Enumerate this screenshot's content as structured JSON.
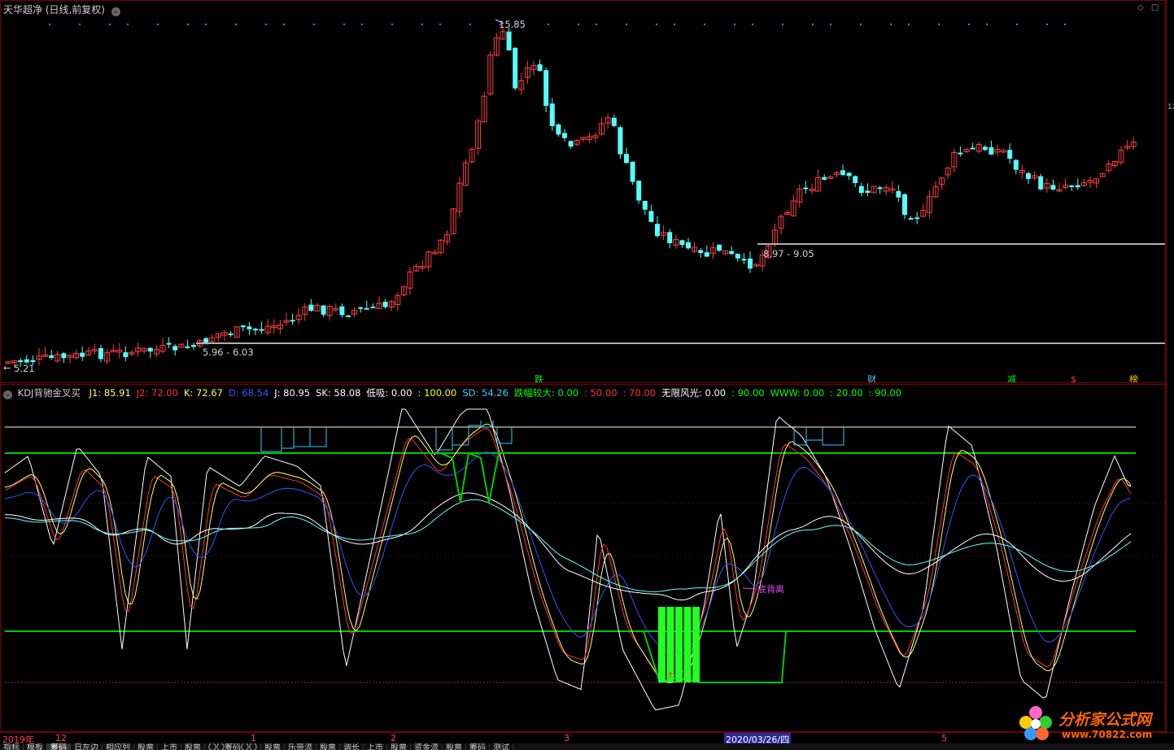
{
  "upper": {
    "title": "天华超净 (日线,前复权)",
    "high_label": "15.85",
    "low_label": "5.21",
    "support_low_label": "5.96 - 6.03",
    "support_high_label": "8.97 - 9.05",
    "right_edge_label": "12",
    "event_markers": [
      {
        "text": "跌",
        "color": "#00ff00"
      },
      {
        "text": "财",
        "color": "#5ac8ff"
      },
      {
        "text": "减",
        "color": "#00ff00"
      },
      {
        "text": "$",
        "color": "#ff3333"
      },
      {
        "text": "榜",
        "color": "#ffcc00"
      }
    ],
    "colors": {
      "up": "#ff3d3d",
      "down": "#54ffff",
      "support_line": "#b0b0b0"
    }
  },
  "lower": {
    "indicator_name": "KDJ背驰金叉买",
    "legend": [
      {
        "label": "J1: 85.91",
        "color": "#ffff66"
      },
      {
        "label": "J2: 72.00",
        "color": "#ff3333"
      },
      {
        "label": "K: 72.67",
        "color": "#ffff66"
      },
      {
        "label": "D: 68.54",
        "color": "#3355ff"
      },
      {
        "label": "J: 80.95",
        "color": "#ffffff"
      },
      {
        "label": "SK: 58.08",
        "color": "#ffffff"
      },
      {
        "label": "低吸: 0.00",
        "color": "#ffffff"
      },
      {
        "label": ": 100.00",
        "color": "#ffff00"
      },
      {
        "label": "SD: 54.26",
        "color": "#33ccff"
      },
      {
        "label": "跌幅较大: 0.00",
        "color": "#00ff00"
      },
      {
        "label": ": 50.00",
        "color": "#ff3333"
      },
      {
        "label": ": 70.00",
        "color": "#ff3333"
      },
      {
        "label": "无限风光: 0.00",
        "color": "#ffffff"
      },
      {
        "label": ": 90.00",
        "color": "#00ff00"
      },
      {
        "label": "WWW: 0.00",
        "color": "#00ff00"
      },
      {
        "label": ": 20.00",
        "color": "#00ff00"
      },
      {
        "label": ": 90.00",
        "color": "#00ff00"
      }
    ],
    "annotation": "底背离",
    "colors": {
      "level_line": "#00cc00",
      "top_line": "#ffffcc",
      "bars": "#22ff22"
    }
  },
  "date_axis": {
    "labels": [
      "2019年",
      "12",
      "1",
      "2",
      "3",
      "2020/03/26/四",
      "5"
    ]
  },
  "bottom_tabs": [
    "指标",
    "模板",
    "筹码",
    "日左边",
    "相应列",
    "股票",
    "上市",
    "股票",
    "〇〇筹码〇〇",
    "股票",
    "乐带流",
    "股票",
    "调长",
    "上市",
    "股票",
    "资金流",
    "股票",
    "筹码",
    "测试"
  ],
  "watermark": {
    "brand": "分析家公式网",
    "url": "www.70822.com"
  }
}
